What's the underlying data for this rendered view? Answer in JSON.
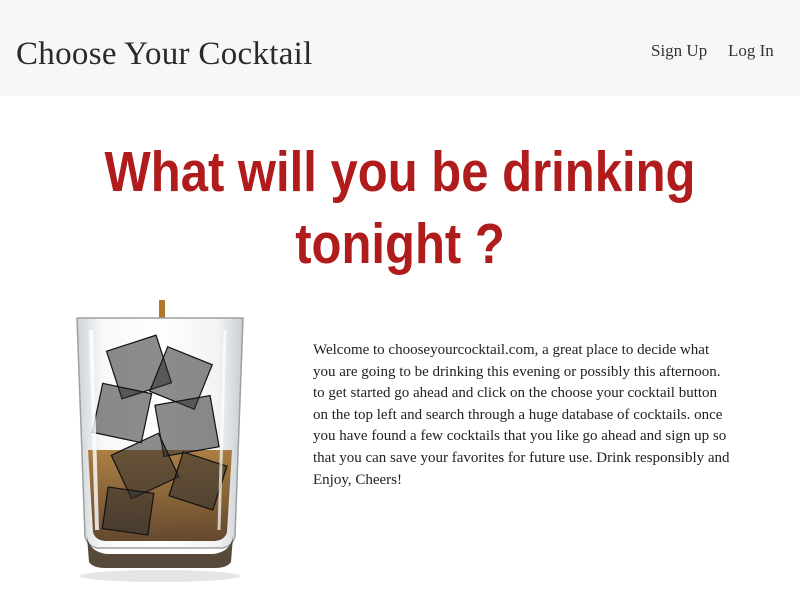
{
  "navbar": {
    "brand": "Choose Your Cocktail",
    "links": [
      {
        "label": "Sign Up"
      },
      {
        "label": "Log In"
      }
    ]
  },
  "hero": {
    "headline_line1": "What will you be drinking",
    "headline_line2": "tonight ?"
  },
  "intro": {
    "text": "Welcome to chooseyourcocktail.com, a great place to decide what you are going to be drinking this evening or possibly this afternoon. to get started go ahead and click on the choose your cocktail button on the top left and search through a huge database of cocktails. once you have found a few cocktails that you like go ahead and sign up so that you can save your favorites for future use. Drink responsibly and Enjoy, Cheers!"
  },
  "colors": {
    "headline": "#b01c1c",
    "navbar_bg": "#f6f7f9",
    "whiskey": "#8a5a1c"
  },
  "image": {
    "subject": "whiskey-glass-with-ice"
  }
}
